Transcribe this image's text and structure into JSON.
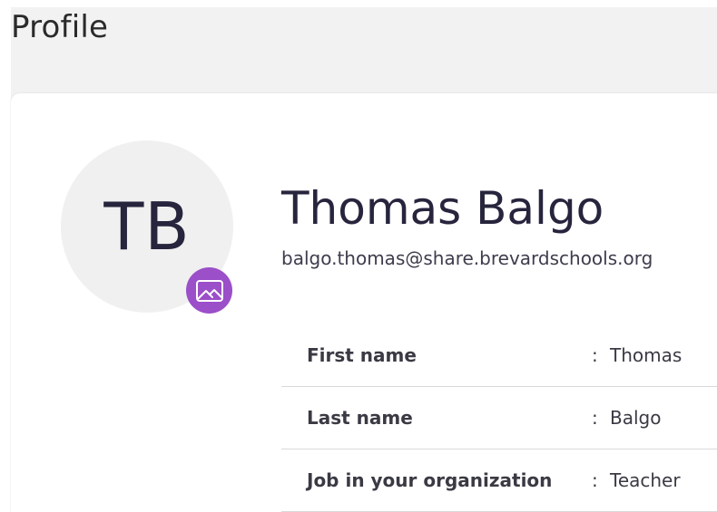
{
  "page": {
    "title": "Profile"
  },
  "profile": {
    "initials": "TB",
    "full_name": "Thomas Balgo",
    "email": "balgo.thomas@share.brevardschools.org",
    "photo_button_icon": "image-icon",
    "accent_color": "#9b4fc8"
  },
  "details": [
    {
      "label": "First name",
      "separator": ":",
      "value": "Thomas"
    },
    {
      "label": "Last name",
      "separator": ":",
      "value": "Balgo"
    },
    {
      "label": "Job in your organization",
      "separator": ":",
      "value": "Teacher"
    }
  ]
}
